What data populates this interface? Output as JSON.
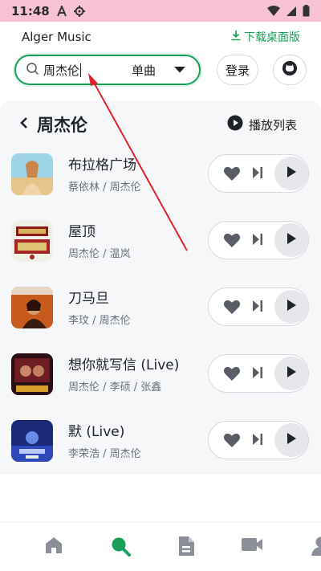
{
  "status_bar": {
    "time": "11:48",
    "icons": [
      "font-a-icon",
      "settings-gear-icon",
      "wifi-icon",
      "cellular-signal-icon",
      "battery-icon"
    ]
  },
  "header": {
    "app_title": "Alger Music",
    "download_label": "下载桌面版"
  },
  "search": {
    "query": "周杰伦",
    "type_label": "单曲",
    "login_label": "登录"
  },
  "results": {
    "title": "周杰伦",
    "playlist_label": "播放列表",
    "songs": [
      {
        "title": "布拉格广场",
        "artist": "蔡依林 / 周杰伦"
      },
      {
        "title": "屋顶",
        "artist": "周杰伦 / 温岚"
      },
      {
        "title": "刀马旦",
        "artist": "李玟 / 周杰伦"
      },
      {
        "title": "想你就写信 (Live)",
        "artist": "周杰伦 / 李硕 / 张鑫"
      },
      {
        "title": "默 (Live)",
        "artist": "李荣浩 / 周杰伦"
      }
    ]
  },
  "nav": {
    "items": [
      "home-icon",
      "search-icon",
      "file-icon",
      "video-icon",
      "user-icon"
    ],
    "active": "search-icon"
  },
  "colors": {
    "accent": "#18a058",
    "status_bar_bg": "#f7c3d2",
    "panel_bg": "#f5f7f9",
    "annotation": "#e0222a"
  }
}
